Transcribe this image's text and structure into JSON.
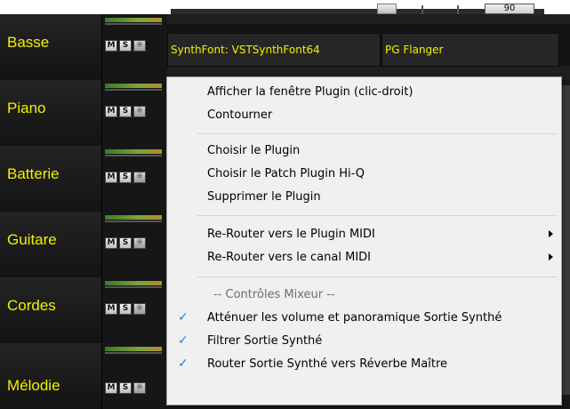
{
  "top_bar": {
    "value": "90"
  },
  "tracks": [
    {
      "name": "Basse",
      "m_label": "M",
      "s_label": "S",
      "x_label": "❋"
    },
    {
      "name": "Piano",
      "m_label": "M",
      "s_label": "S",
      "x_label": "❋"
    },
    {
      "name": "Batterie",
      "m_label": "M",
      "s_label": "S",
      "x_label": "❋"
    },
    {
      "name": "Guitare",
      "m_label": "M",
      "s_label": "S",
      "x_label": "❋"
    },
    {
      "name": "Cordes",
      "m_label": "M",
      "s_label": "S",
      "x_label": "❋"
    },
    {
      "name": "Mélodie",
      "m_label": "M",
      "s_label": "S",
      "x_label": "❋"
    }
  ],
  "plugins": {
    "slot1": "SynthFont: VSTSynthFont64",
    "slot2": "PG Flanger"
  },
  "context_menu": {
    "items": [
      {
        "label": "Afficher la fenêtre Plugin (clic-droit)"
      },
      {
        "label": "Contourner"
      },
      {
        "label": "Choisir le Plugin"
      },
      {
        "label": "Choisir le Patch Plugin Hi-Q"
      },
      {
        "label": "Supprimer le Plugin"
      },
      {
        "label": "Re-Router vers le Plugin MIDI",
        "submenu": true
      },
      {
        "label": "Re-Router vers le canal MIDI",
        "submenu": true
      },
      {
        "label": "-- Contrôles Mixeur --"
      },
      {
        "label": "Atténuer les volume et panoramique Sortie Synthé",
        "checked": true
      },
      {
        "label": "Filtrer Sortie Synthé",
        "checked": true
      },
      {
        "label": "Router Sortie Synthé vers Réverbe Maître",
        "checked": true
      }
    ],
    "check_glyph": "✓",
    "accent_color": "#2e7bd6"
  },
  "colors": {
    "track_name": "#f3f000",
    "panel_bg": "#1f1f1f",
    "menu_bg": "#f0f0f0"
  }
}
